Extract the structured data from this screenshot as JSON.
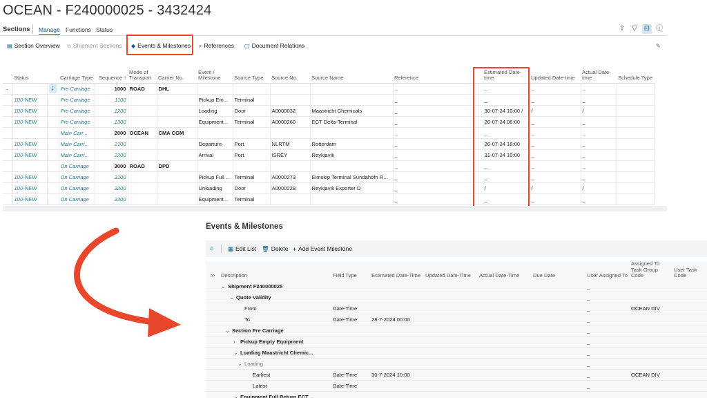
{
  "window": {
    "title": "OCEAN - F240000025 - 3432424"
  },
  "sections_header": {
    "label": "Sections",
    "menus": [
      "Manage",
      "Functions",
      "Status"
    ],
    "icons": [
      "share-icon",
      "filter-icon",
      "expand-icon",
      "info-icon"
    ]
  },
  "subtoolbar": {
    "buttons": [
      {
        "label": "Section Overview",
        "icon": "section-overview-icon",
        "enabled": true
      },
      {
        "label": "Shipment Sections",
        "icon": "shipment-sections-icon",
        "enabled": false
      },
      {
        "label": "Events & Milestones",
        "icon": "events-milestones-icon",
        "enabled": true,
        "highlighted": true
      },
      {
        "label": "References",
        "icon": "references-icon",
        "enabled": true
      },
      {
        "label": "Document Relations",
        "icon": "document-relations-icon",
        "enabled": true
      }
    ],
    "pin_icon": "pin-icon"
  },
  "sections_table": {
    "columns": [
      "Status",
      "Carriage Type",
      "Sequence ↑",
      "Mode of Transport",
      "Carrier No.",
      "Event / Milestone",
      "Source Type",
      "Source No.",
      "Source Name",
      "Reference",
      "Estimated Date-time",
      "Updated Date-time",
      "Actual Date-time",
      "Schedule Type"
    ],
    "rows": [
      {
        "status": "",
        "carriage": "Pre Carriage",
        "seq": "1000",
        "mode": "ROAD",
        "carrier": "DHL",
        "event": "",
        "stype": "",
        "sno": "",
        "sname": "",
        "ref": "_",
        "est": "_",
        "upd": "_",
        "act": "_",
        "sched": "",
        "bold": true,
        "current": true
      },
      {
        "status": "100-NEW",
        "carriage": "Pre Carriage",
        "seq": "1100",
        "mode": "",
        "carrier": "",
        "event": "Pickup Em...",
        "stype": "Terminal",
        "sno": "",
        "sname": "",
        "ref": "_",
        "est": "_",
        "upd": "_",
        "act": "_",
        "sched": ""
      },
      {
        "status": "100-NEW",
        "carriage": "Pre Carriage",
        "seq": "1200",
        "mode": "",
        "carrier": "",
        "event": "Loading",
        "stype": "Door",
        "sno": "A0000032",
        "sname": "Maastricht Chemicals",
        "ref": "_",
        "est": "30-07-24 10:00 /",
        "upd": "/",
        "act": "/",
        "sched": ""
      },
      {
        "status": "100-NEW",
        "carriage": "Pre Carriage",
        "seq": "1300",
        "mode": "",
        "carrier": "",
        "event": "Equipment...",
        "stype": "Terminal",
        "sno": "A0000260",
        "sname": "ECT Delta-Terminal",
        "ref": "_",
        "est": "26-07-24 06:00",
        "upd": "_",
        "act": "_",
        "sched": ""
      },
      {
        "status": "",
        "carriage": "Main Carr...",
        "seq": "2000",
        "mode": "OCEAN",
        "carrier": "CMA CGM",
        "event": "",
        "stype": "",
        "sno": "",
        "sname": "",
        "ref": "_",
        "est": "_",
        "upd": "_",
        "act": "_",
        "sched": "",
        "bold": true
      },
      {
        "status": "100-NEW",
        "carriage": "Main Carri...",
        "seq": "2100",
        "mode": "",
        "carrier": "",
        "event": "Departure",
        "stype": "Port",
        "sno": "NLRTM",
        "sname": "Rotterdam",
        "ref": "_",
        "est": "26-07-24 18:00",
        "upd": "_",
        "act": "_",
        "sched": ""
      },
      {
        "status": "100-NEW",
        "carriage": "Main Carri...",
        "seq": "2200",
        "mode": "",
        "carrier": "",
        "event": "Arrival",
        "stype": "Port",
        "sno": "ISREY",
        "sname": "Reykjavik",
        "ref": "_",
        "est": "31-07-24 10:00",
        "upd": "_",
        "act": "_",
        "sched": ""
      },
      {
        "status": "",
        "carriage": "On Carriage",
        "seq": "3000",
        "mode": "ROAD",
        "carrier": "DPD",
        "event": "",
        "stype": "",
        "sno": "",
        "sname": "",
        "ref": "_",
        "est": "_",
        "upd": "_",
        "act": "_",
        "sched": "",
        "bold": true
      },
      {
        "status": "100-NEW",
        "carriage": "On Carriage",
        "seq": "3100",
        "mode": "",
        "carrier": "",
        "event": "Pickup Full ...",
        "stype": "Terminal",
        "sno": "A0000273",
        "sname": "Eimskip Terminal Sundahöfn R...",
        "ref": "_",
        "est": "_",
        "upd": "_",
        "act": "_",
        "sched": ""
      },
      {
        "status": "100-NEW",
        "carriage": "On Carriage",
        "seq": "3200",
        "mode": "",
        "carrier": "",
        "event": "Unloading",
        "stype": "Door",
        "sno": "A0000228",
        "sname": "Reykjavik Exporter D",
        "ref": "_",
        "est": "/",
        "upd": "/",
        "act": "/",
        "sched": ""
      },
      {
        "status": "100-NEW",
        "carriage": "On Carriage",
        "seq": "3300",
        "mode": "",
        "carrier": "",
        "event": "Equipment...",
        "stype": "Terminal",
        "sno": "",
        "sname": "",
        "ref": "_",
        "est": "_",
        "upd": "_",
        "act": "_",
        "sched": ""
      }
    ]
  },
  "events_panel": {
    "title": "Events & Milestones",
    "toolbar": {
      "search_icon": "search-icon",
      "edit_list": "Edit List",
      "delete": "Delete",
      "add": "Add Event Milestone"
    },
    "columns": [
      "Description",
      "Field Type",
      "Estimated Date-Time",
      "Updated Date-Time",
      "Actual Date-Time",
      "Due Date",
      "User Assigned To",
      "Assigned To Task Group Code",
      "User Task Code"
    ],
    "rows": [
      {
        "desc": "Shipment F240000025",
        "level": 0,
        "chev": "v",
        "style": "b",
        "ftype": "",
        "est": "",
        "user": "_",
        "group": ""
      },
      {
        "desc": "Quote Validity",
        "level": 1,
        "chev": "v",
        "style": "b",
        "ftype": "",
        "est": "",
        "user": "_",
        "group": ""
      },
      {
        "desc": "From",
        "level": 2,
        "chev": "",
        "style": "",
        "ftype": "Date-Time",
        "est": "",
        "user": "_",
        "group": "OCEAN DIV"
      },
      {
        "desc": "To",
        "level": 2,
        "chev": "",
        "style": "",
        "ftype": "Date-Time",
        "est": "28-7-2024 00:00",
        "user": "_",
        "group": ""
      },
      {
        "desc": "Section Pre Carriage",
        "level": 0.5,
        "chev": "v",
        "style": "b",
        "ftype": "",
        "est": "",
        "user": "_",
        "group": ""
      },
      {
        "desc": "Pickup Empty Equipment",
        "level": 1.5,
        "chev": ">",
        "style": "b",
        "ftype": "",
        "est": "",
        "user": "_",
        "group": ""
      },
      {
        "desc": "Loading Maastricht Chemic...",
        "level": 1.5,
        "chev": "v",
        "style": "b",
        "ftype": "",
        "est": "",
        "user": "_",
        "group": ""
      },
      {
        "desc": "Loading",
        "level": 2,
        "chev": "v",
        "style": "grey",
        "ftype": "",
        "est": "",
        "user": "_",
        "group": ""
      },
      {
        "desc": "Earliest",
        "level": 3,
        "chev": "",
        "style": "",
        "ftype": "Date-Time",
        "est": "30-7-2024 10:00",
        "user": "_",
        "group": "OCEAN DIV"
      },
      {
        "desc": "Latest",
        "level": 3,
        "chev": "",
        "style": "",
        "ftype": "Date-Time",
        "est": "",
        "user": "_",
        "group": ""
      },
      {
        "desc": "Equipment Full Return ECT ...",
        "level": 1.5,
        "chev": "v",
        "style": "b",
        "ftype": "",
        "est": "",
        "user": "_",
        "group": ""
      }
    ]
  },
  "annotations": {
    "highlight_color": "#e8472b"
  }
}
